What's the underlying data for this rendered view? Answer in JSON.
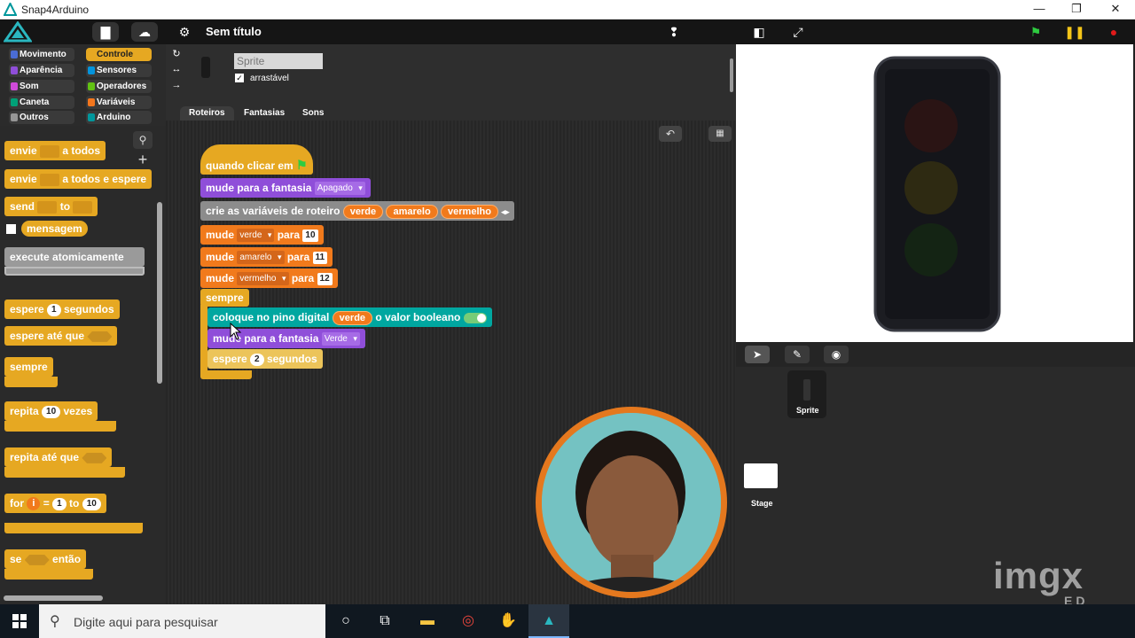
{
  "window": {
    "title": "Snap4Arduino"
  },
  "toolbar": {
    "project_title": "Sem título"
  },
  "categories": [
    {
      "label": "Movimento",
      "color": "#4a6cd4"
    },
    {
      "label": "Controle",
      "color": "#e6a822"
    },
    {
      "label": "Aparência",
      "color": "#8f4ed9"
    },
    {
      "label": "Sensores",
      "color": "#0494dc"
    },
    {
      "label": "Som",
      "color": "#cf4ad9"
    },
    {
      "label": "Operadores",
      "color": "#62c213"
    },
    {
      "label": "Caneta",
      "color": "#00a178"
    },
    {
      "label": "Variáveis",
      "color": "#f3761d"
    },
    {
      "label": "Outros",
      "color": "#969696"
    },
    {
      "label": "Arduino",
      "color": "#00979c"
    }
  ],
  "palette": {
    "envie_label": "envie",
    "a_todos_label": "a todos",
    "a_todos_espere_label": "a todos e espere",
    "send_label": "send",
    "to_label": "to",
    "mensagem_label": "mensagem",
    "execute_label": "execute atomicamente",
    "espere_label": "espere",
    "espere_value": "1",
    "segundos_label": "segundos",
    "espere_ate_label": "espere até que",
    "sempre_label": "sempre",
    "repita_label": "repita",
    "repita_value": "10",
    "vezes_label": "vezes",
    "repita_ate_label": "repita até que",
    "for_label": "for",
    "for_var": "i",
    "for_eq": "=",
    "for_from": "1",
    "for_to_label": "to",
    "for_to": "10",
    "se_label": "se",
    "entao_label": "então"
  },
  "sprite": {
    "name_placeholder": "Sprite",
    "draggable_label": "arrastável",
    "draggable_check": "✓"
  },
  "tabs": [
    "Roteiros",
    "Fantasias",
    "Sons"
  ],
  "script": {
    "hat_label": "quando clicar em",
    "costume1_label": "mude para a fantasia",
    "costume1_value": "Apagado",
    "vars_label": "crie as variáveis de roteiro",
    "vars": [
      "verde",
      "amarelo",
      "vermelho"
    ],
    "set_label": "mude",
    "para_label": "para",
    "sets": [
      {
        "var": "verde",
        "value": "10"
      },
      {
        "var": "amarelo",
        "value": "11"
      },
      {
        "var": "vermelho",
        "value": "12"
      }
    ],
    "sempre_label": "sempre",
    "digital_label": "coloque no pino digital",
    "digital_var": "verde",
    "digital_value_label": "o valor booleano",
    "costume2_label": "mude para a fantasia",
    "costume2_value": "Verde",
    "wait_label": "espere",
    "wait_value": "2",
    "wait_unit": "segundos"
  },
  "corral": {
    "sprite_label": "Sprite",
    "stage_label": "Stage"
  },
  "watermark": {
    "main": "imgx",
    "sub": "ED"
  },
  "taskbar": {
    "search_placeholder": "Digite aqui para pesquisar"
  }
}
